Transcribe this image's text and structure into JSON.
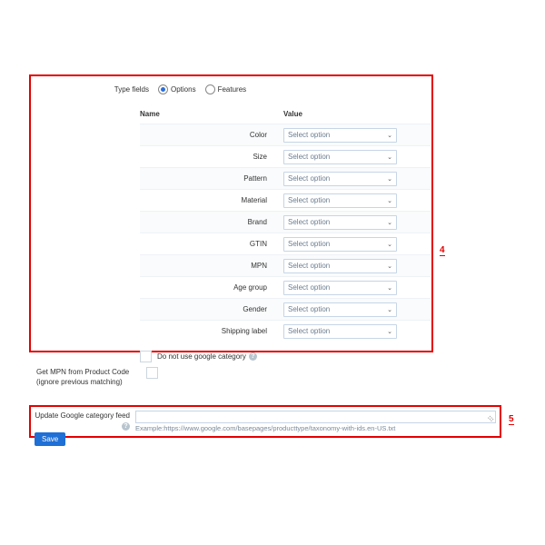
{
  "typeFields": {
    "label": "Type fields",
    "opt1": "Options",
    "opt2": "Features"
  },
  "table": {
    "h1": "Name",
    "h2": "Value",
    "placeholder": "Select option",
    "rows": [
      "Color",
      "Size",
      "Pattern",
      "Material",
      "Brand",
      "GTIN",
      "MPN",
      "Age group",
      "Gender",
      "Shipping label"
    ]
  },
  "noGcat": "Do not use google category",
  "mpn": "Get MPN from Product Code (ignore previous matching)",
  "feed": {
    "label": "Update Google category feed",
    "save": "Save",
    "example": "Example:https://www.google.com/basepages/producttype/taxonomy-with-ids.en-US.txt"
  },
  "annot": {
    "a4": "4",
    "a5": "5"
  }
}
